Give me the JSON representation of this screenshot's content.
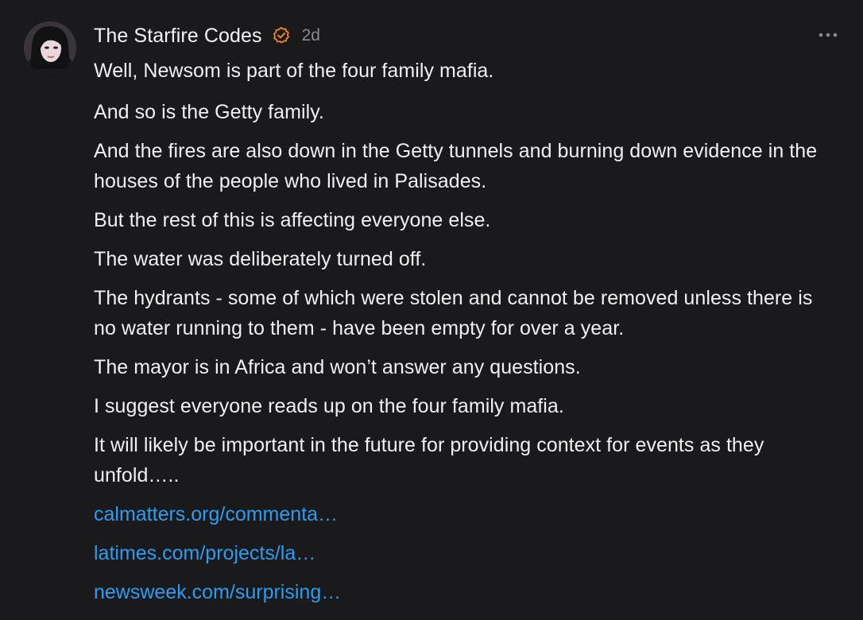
{
  "post": {
    "author": "The Starfire Codes",
    "time": "2d",
    "paragraphs": [
      "Well, Newsom is part of the four family mafia.",
      "And so is the Getty family.",
      "And the fires are also down in the Getty tunnels and burning down evidence in the houses of the people who lived in Palisades.",
      "But the rest of this is affecting everyone else.",
      "The water was deliberately turned off.",
      "The hydrants - some of which were stolen and cannot be removed unless there is no water running to them - have been empty for over a year.",
      "The mayor is in Africa and won’t answer any questions.",
      "I suggest everyone reads up on the four family mafia.",
      "It will likely be important in the future for providing context for events as they unfold….."
    ],
    "links": [
      "calmatters.org/commenta…",
      "latimes.com/projects/la…",
      "newsweek.com/surprising…"
    ]
  },
  "icons": {
    "verified": "verified-check-icon",
    "more": "more-horizontal-icon",
    "avatar": "user-avatar"
  },
  "colors": {
    "background": "#1a1a1c",
    "text": "#f0f0f2",
    "muted": "#8a8a90",
    "link": "#2d9cf0",
    "verified": "#f0822a"
  }
}
